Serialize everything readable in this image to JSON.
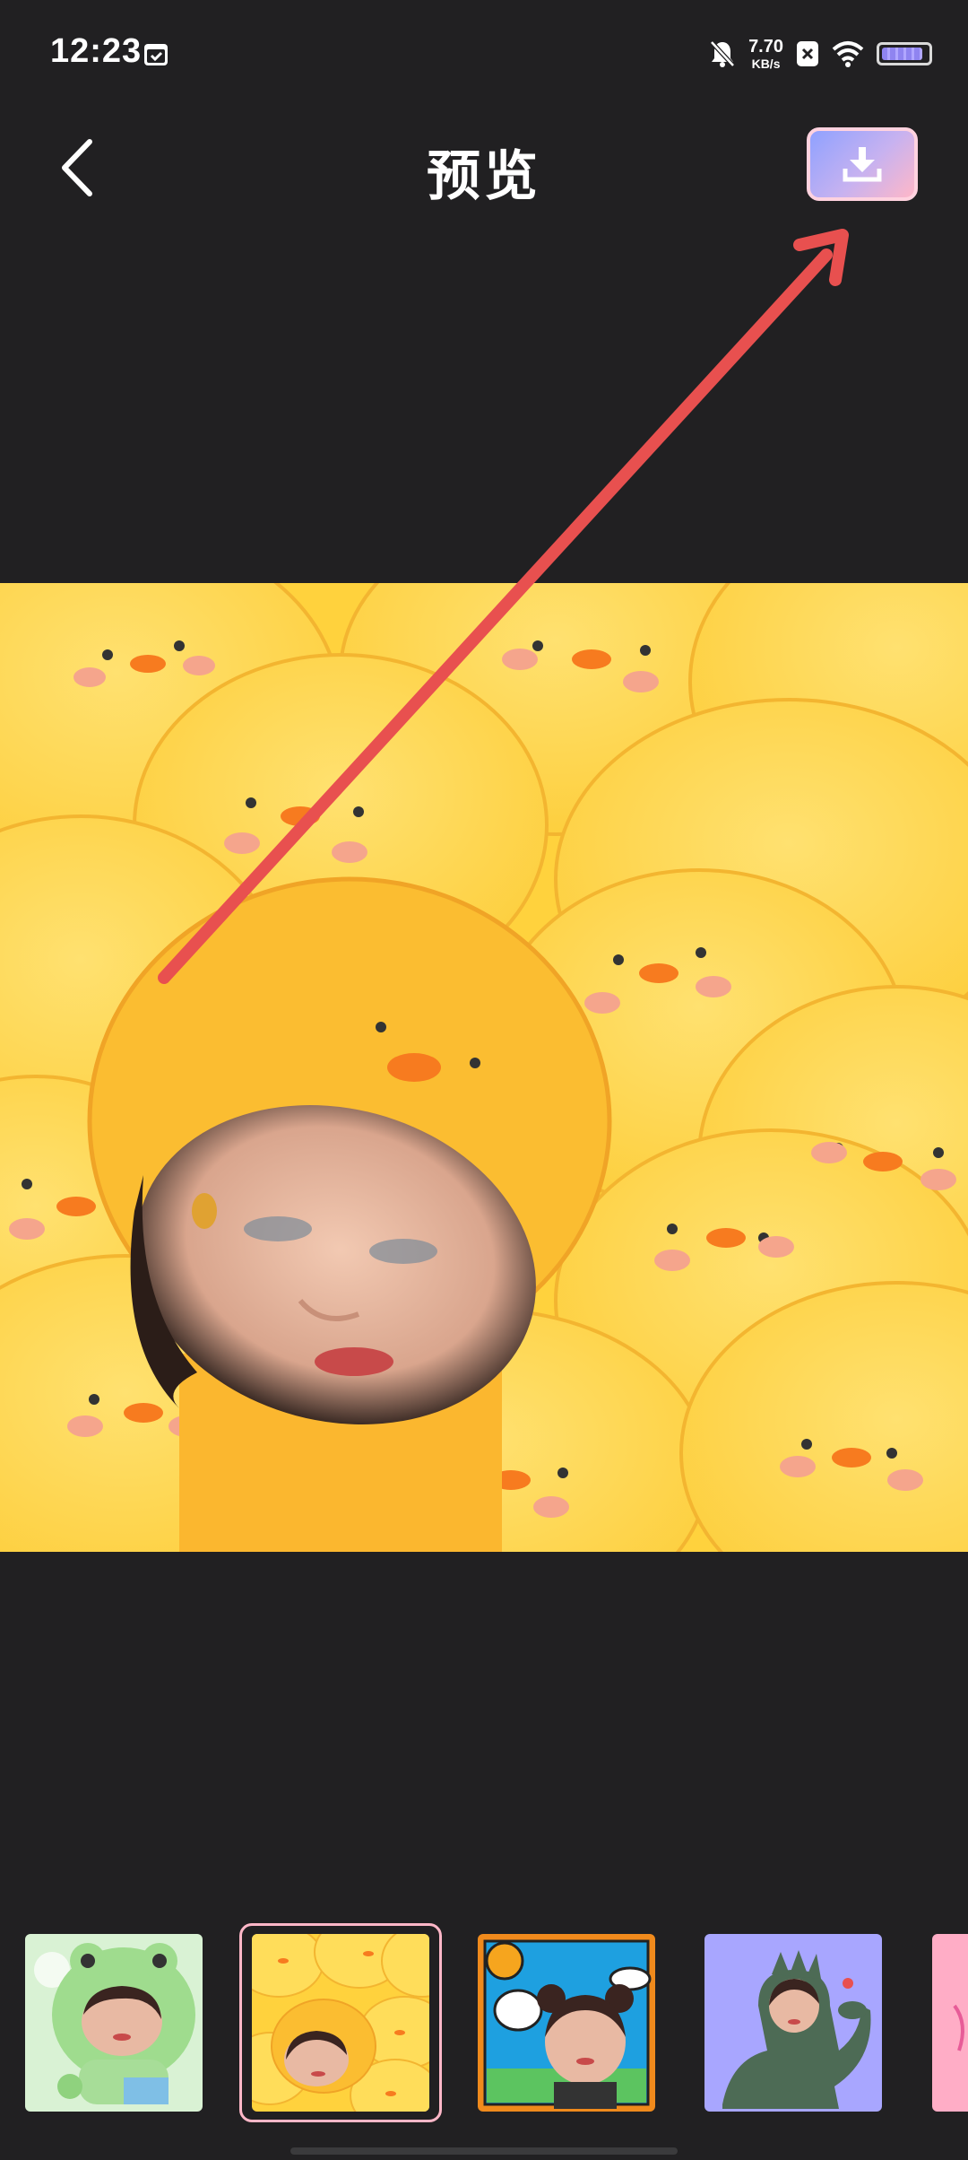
{
  "status_bar": {
    "time": "12:23",
    "net_speed_value": "7.70",
    "net_speed_unit": "KB/s",
    "battery_level": 0.9,
    "icons": [
      "calendar-check-icon",
      "bell-off-icon",
      "x-box-icon",
      "wifi-icon",
      "battery-icon"
    ]
  },
  "header": {
    "title": "预览",
    "back_icon": "chevron-left-icon",
    "download_icon": "download-icon"
  },
  "preview": {
    "template_name": "yellow-chicks"
  },
  "templates": [
    {
      "name": "frog-hood",
      "bg": "#cdeec9",
      "selected": false
    },
    {
      "name": "yellow-chicks",
      "bg": "#ffd23d",
      "selected": true
    },
    {
      "name": "cartoon-sky",
      "bg": "#1ea0e0",
      "selected": false
    },
    {
      "name": "green-dinosaur",
      "bg": "#a8a6ff",
      "selected": false
    },
    {
      "name": "pink-partial",
      "bg": "#ffadc6",
      "selected": false
    }
  ],
  "colors": {
    "background": "#212022",
    "accent_pink": "#ffb7c8",
    "arrow_red": "#e8504f"
  }
}
